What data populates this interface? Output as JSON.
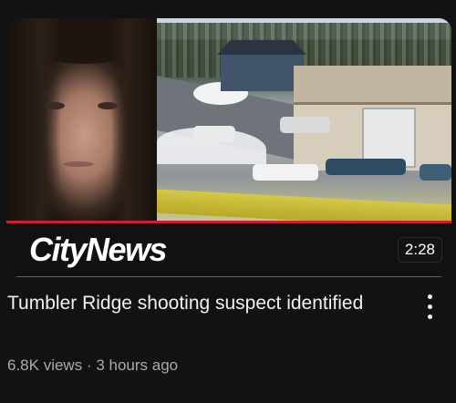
{
  "video": {
    "brand_logo_text": "CityNews",
    "duration": "2:28",
    "title": "Tumbler Ridge shooting suspect identified",
    "views": "6.8K views",
    "separator": "·",
    "age": "3 hours ago"
  },
  "colors": {
    "background": "#121212",
    "accent_red": "#e22a49",
    "title_text": "#f1f1f1",
    "meta_text": "#aaaaaa"
  },
  "icons": {
    "menu": "more-vertical-icon"
  }
}
